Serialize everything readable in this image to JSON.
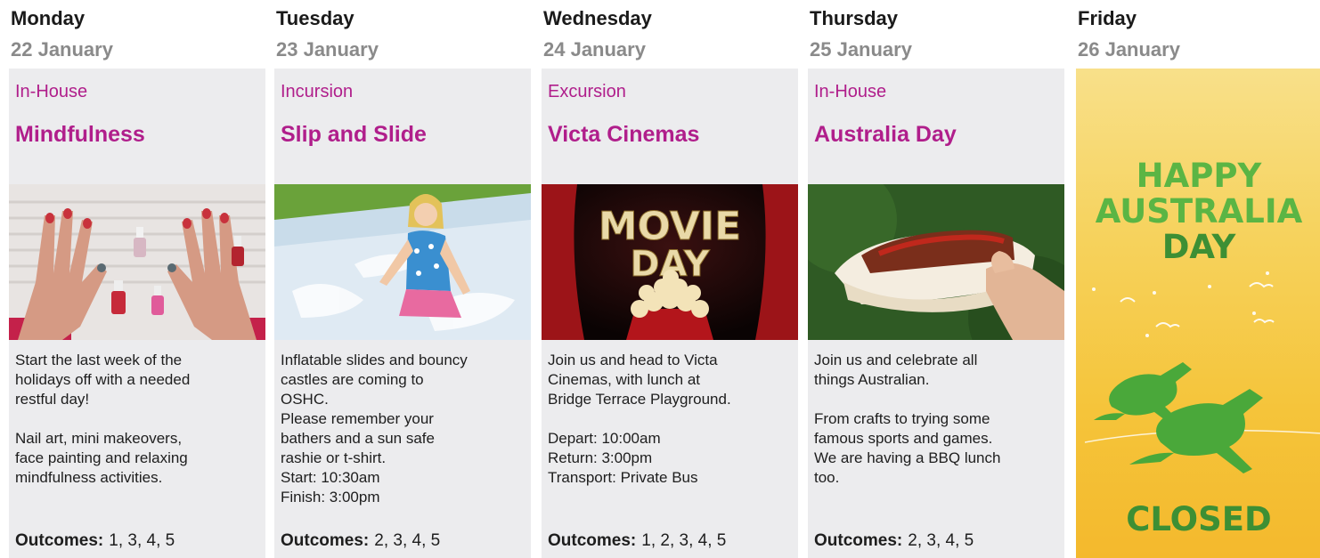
{
  "days": [
    {
      "day": "Monday",
      "date": "22 January",
      "category": "In-House",
      "title": "Mindfulness",
      "description": [
        "Start the last week of the",
        "holidays off with a needed",
        "restful day!",
        "",
        "Nail art, mini makeovers,",
        "face painting and relaxing",
        "mindfulness activities."
      ],
      "outcomes_label": "Outcomes:",
      "outcomes_values": "1, 3, 4, 5"
    },
    {
      "day": "Tuesday",
      "date": "23 January",
      "category": "Incursion",
      "title": "Slip and Slide",
      "description": [
        "Inflatable slides and bouncy",
        "castles are coming to",
        "OSHC.",
        "Please remember your",
        "bathers and a sun safe",
        "rashie or t-shirt.",
        "Start: 10:30am",
        "Finish: 3:00pm"
      ],
      "outcomes_label": "Outcomes:",
      "outcomes_values": "2, 3, 4, 5"
    },
    {
      "day": "Wednesday",
      "date": "24 January",
      "category": "Excursion",
      "title": "Victa Cinemas",
      "description": [
        "Join us and head to Victa",
        "Cinemas, with lunch at",
        "Bridge Terrace Playground.",
        "",
        "Depart: 10:00am",
        "Return: 3:00pm",
        "Transport: Private Bus"
      ],
      "outcomes_label": "Outcomes:",
      "outcomes_values": "1, 2, 3, 4, 5",
      "photo_text": [
        "MOVIE",
        "DAY"
      ]
    },
    {
      "day": "Thursday",
      "date": "25 January",
      "category": "In-House",
      "title": "Australia Day",
      "description": [
        "Join us and celebrate all",
        "things Australian.",
        "",
        "From crafts to trying some",
        "famous sports and games.",
        "We are having a BBQ lunch",
        "too."
      ],
      "outcomes_label": "Outcomes:",
      "outcomes_values": "2, 3, 4, 5"
    }
  ],
  "friday": {
    "day": "Friday",
    "date": "26 January",
    "banner_lines": [
      "HAPPY",
      "AUSTRALIA",
      "DAY"
    ],
    "closed": "CLOSED"
  },
  "colors": {
    "accent": "#b01e8b",
    "card_bg": "#ececee",
    "date_grey": "#8a8a8a",
    "green_light": "#5bb544",
    "green_dark": "#3d8f34",
    "gold": "#f5c43a"
  }
}
